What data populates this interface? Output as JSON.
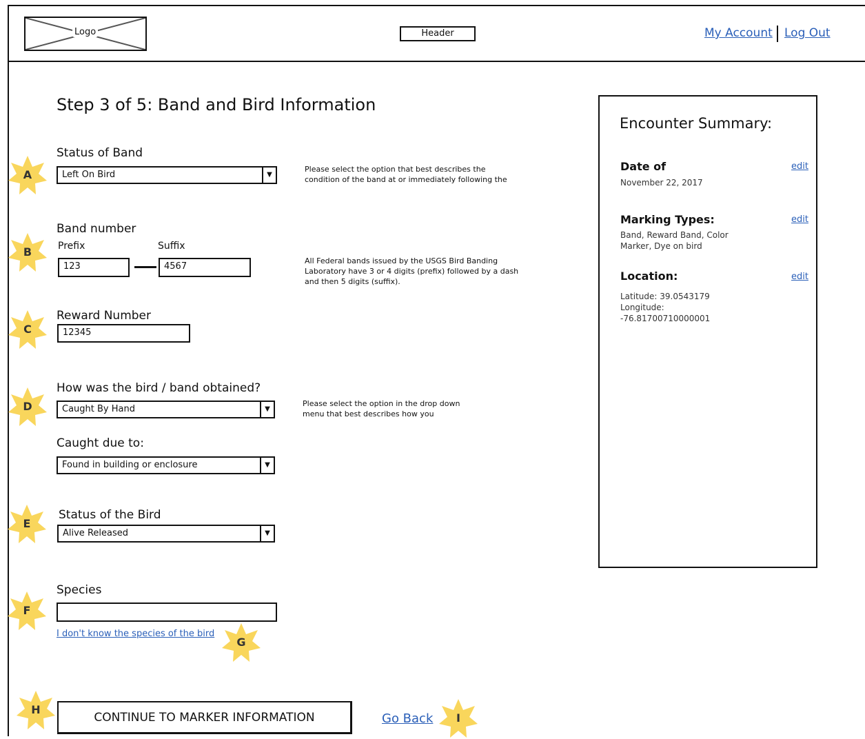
{
  "header": {
    "logo_label": "Logo",
    "header_label": "Header",
    "my_account": "My Account",
    "log_out": "Log Out"
  },
  "page_title": "Step 3 of 5: Band and Bird Information",
  "form": {
    "status_of_band": {
      "label": "Status of Band",
      "value": "Left On Bird",
      "help": [
        "Please select the option that best describes the",
        "condition of the band at or immediately following the"
      ]
    },
    "band_number": {
      "label": "Band number",
      "prefix_label": "Prefix",
      "suffix_label": "Suffix",
      "prefix_value": "123",
      "suffix_value": "4567",
      "help": [
        "All Federal bands issued by the USGS Bird Banding",
        "Laboratory have 3 or 4 digits (prefix) followed by a dash",
        "and then 5 digits (suffix)."
      ]
    },
    "reward_number": {
      "label": "Reward Number",
      "value": "12345"
    },
    "obtained": {
      "label": "How was the bird / band obtained?",
      "value": "Caught By Hand",
      "help": [
        "Please select the option in the drop down",
        "menu that best describes how you"
      ]
    },
    "caught_due_to": {
      "label": "Caught due to:",
      "value": "Found in building or enclosure"
    },
    "status_of_bird": {
      "label": "Status of the Bird",
      "value": "Alive Released"
    },
    "species": {
      "label": "Species",
      "value": "",
      "unknown_link": "I don't know the species of the bird"
    },
    "continue_button": "CONTINUE TO MARKER INFORMATION",
    "go_back": "Go Back"
  },
  "badges": [
    "A",
    "B",
    "C",
    "D",
    "E",
    "F",
    "G",
    "H",
    "I"
  ],
  "badge_color": "#f9d65c",
  "link_color": "#2a5fb8",
  "summary": {
    "title": "Encounter Summary:",
    "edit_label": "edit",
    "date_heading": "Date of",
    "date_value": "November 22, 2017",
    "marking_heading": "Marking Types:",
    "marking_value": [
      "Band, Reward Band, Color",
      "Marker, Dye on bird"
    ],
    "location_heading": "Location:",
    "location_lines": [
      "Latitude: 39.0543179",
      "Longitude:",
      "-76.81700710000001"
    ]
  }
}
